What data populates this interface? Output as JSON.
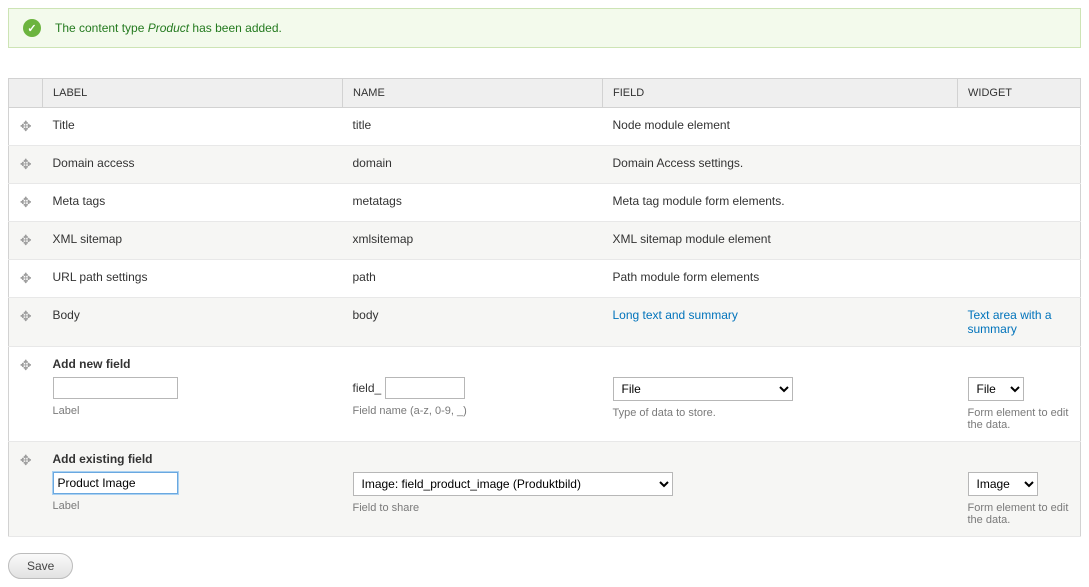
{
  "status": {
    "prefix": "The content type ",
    "type_name": "Product",
    "suffix": " has been added."
  },
  "columns": {
    "label": "LABEL",
    "name": "NAME",
    "field": "FIELD",
    "widget": "WIDGET"
  },
  "rows": [
    {
      "label": "Title",
      "name": "title",
      "field": "Node module element",
      "widget": ""
    },
    {
      "label": "Domain access",
      "name": "domain",
      "field": "Domain Access settings.",
      "widget": ""
    },
    {
      "label": "Meta tags",
      "name": "metatags",
      "field": "Meta tag module form elements.",
      "widget": ""
    },
    {
      "label": "XML sitemap",
      "name": "xmlsitemap",
      "field": "XML sitemap module element",
      "widget": ""
    },
    {
      "label": "URL path settings",
      "name": "path",
      "field": "Path module form elements",
      "widget": ""
    }
  ],
  "body_row": {
    "label": "Body",
    "name": "body",
    "field_link": "Long text and summary",
    "widget_link": "Text area with a summary"
  },
  "add_new": {
    "heading": "Add new field",
    "label_value": "",
    "label_help": "Label",
    "name_prefix": "field_",
    "name_value": "",
    "name_help": "Field name (a-z, 0-9, _)",
    "type_selected": "File",
    "type_help": "Type of data to store.",
    "widget_selected": "File",
    "widget_help": "Form element to edit the data."
  },
  "add_existing": {
    "heading": "Add existing field",
    "label_value": "Product Image",
    "label_help": "Label",
    "share_selected": "Image: field_product_image (Produktbild)",
    "share_help": "Field to share",
    "widget_selected": "Image",
    "widget_help": "Form element to edit the data."
  },
  "save_label": "Save"
}
